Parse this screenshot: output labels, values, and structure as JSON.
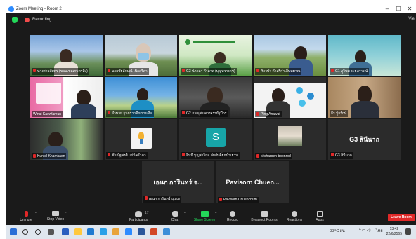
{
  "window": {
    "title": "Zoom Meeting - Room 2",
    "minimize": "–",
    "maximize": "☐",
    "close": "✕"
  },
  "meeting": {
    "recording_label": "Recording",
    "view_label": "Vie"
  },
  "participants": [
    {
      "name": "นางสาวอัมพร (ขอบเขตเกษตรสิ่ง)",
      "muted": true
    },
    {
      "name": "นายชัยลักษณ์ เนื่อสรีสา",
      "muted": true
    },
    {
      "name": "G3 ปภาดา กำดาล (บุญทวาราช)",
      "muted": true
    },
    {
      "name": "ศิลาบัว คำสรีกำเลื่นหมาณ",
      "muted": true
    },
    {
      "name": "G1 ภูรินท์ ระยะการณ์",
      "muted": true
    },
    {
      "name": "Winai Kaewlamun",
      "muted": false
    },
    {
      "name": "อำนวย ยุนธราวดีณรวนที่น",
      "muted": true
    },
    {
      "name": "G2 ภาณุศร ดวงจรรยัฐปีกร",
      "muted": true
    },
    {
      "name": "Ping Anawat",
      "muted": true
    },
    {
      "name": "ธีร ปูยรักษ์",
      "muted": false
    },
    {
      "name": "Kuntel Khamkaen",
      "muted": true
    },
    {
      "name": "ชัยณัฐพงศ์ แก่นิครำภา",
      "muted": true
    },
    {
      "name": "สินที บุญสาริกุล ภัยสันติ๊ยกน้ำเยาน",
      "muted": true,
      "avatar_letter": "S"
    },
    {
      "name": "kitcharoen boonrod",
      "muted": true
    },
    {
      "name": "G3 สินีนาถ",
      "muted": true,
      "display_name": "G3 สินีนาถ"
    },
    {
      "name": "เอนก การินทร์ บุญเจ",
      "muted": true,
      "display_name": "เอนก การินทร์ จ..."
    },
    {
      "name": "Pavisorn Chuenchum",
      "muted": true,
      "display_name": "Pavisorn Chuen..."
    }
  ],
  "toolbar": {
    "unmute": "Unmute",
    "stop_video": "Stop Video",
    "participants": "Participants",
    "participants_count": "17",
    "chat": "Chat",
    "share_screen": "Share Screen",
    "record": "Record",
    "breakout": "Breakout Rooms",
    "reactions": "Reactions",
    "apps": "Apps",
    "leave": "Leave Room"
  },
  "taskbar": {
    "weather": "33°C ฝน",
    "lang": "ไทย",
    "time": "13:42",
    "date": "22/6/2565"
  },
  "colors": {
    "accent_blue": "#2d8cff",
    "leave_red": "#e02828",
    "mute_red": "#e02828",
    "active_speaker": "#e4e01e",
    "share_green": "#23d959"
  }
}
